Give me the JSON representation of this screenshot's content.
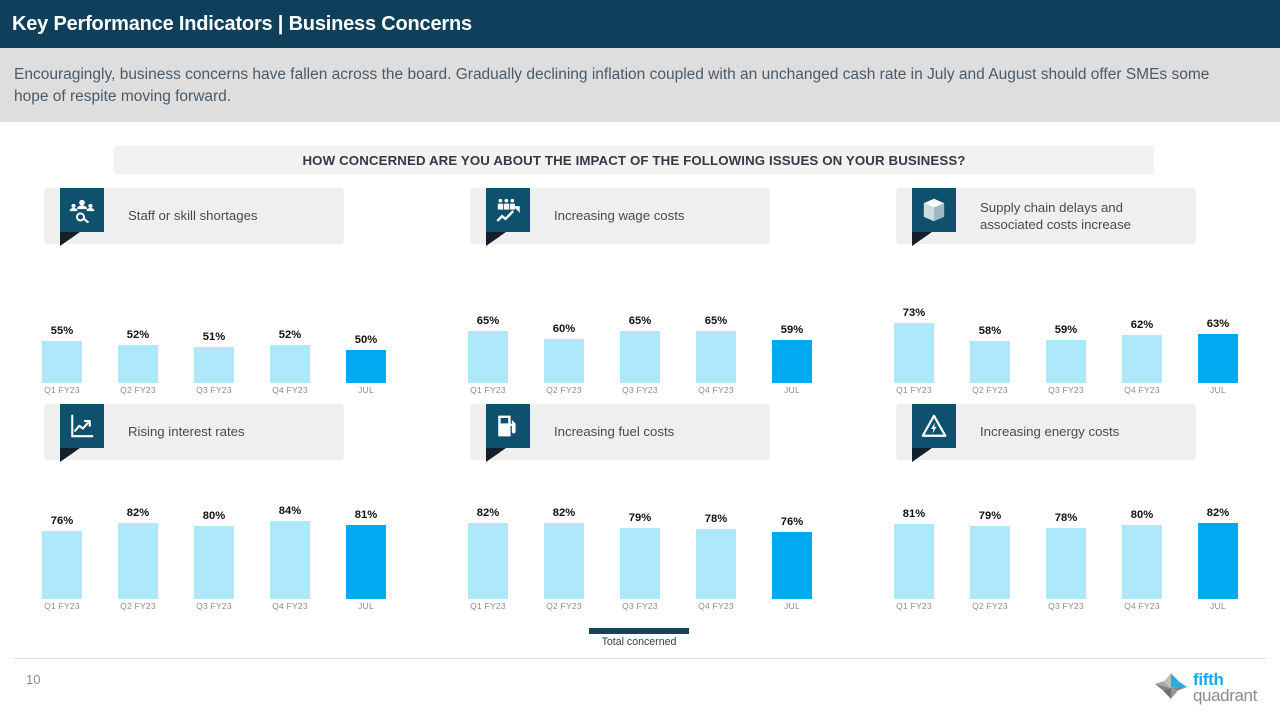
{
  "header": {
    "title": "Key Performance Indicators | Business Concerns",
    "subtitle": "Encouragingly, business concerns have fallen across the board. Gradually declining inflation coupled with an unchanged cash rate in July and August should offer SMEs some hope of respite moving forward.",
    "bar_color": "#0E405C",
    "subtitle_band_color": "#DEDEDE"
  },
  "question": {
    "text": "HOW CONCERNED ARE YOU ABOUT THE IMPACT OF THE FOLLOWING ISSUES ON YOUR BUSINESS?"
  },
  "legend": {
    "label": "Total concerned",
    "swatch_color": "#14455F"
  },
  "footer": {
    "page_number": "10",
    "logo_word1": "fifth",
    "logo_word2": "quadrant",
    "logo_accent": "#1CA8E8",
    "logo_gray": "#8C8C8C"
  },
  "colors": {
    "bar": "#ADE8FB",
    "bar_highlight": "#00A9F0",
    "icon_box": "#0E506D",
    "panel_plate": "#EFEFEF"
  },
  "chart_data": [
    {
      "type": "bar",
      "title": "Staff or skill shortages",
      "icon": "people-search-icon",
      "categories": [
        "Q1 FY23",
        "Q2 FY23",
        "Q3 FY23",
        "Q4 FY23",
        "JUL"
      ],
      "values": [
        55,
        52,
        51,
        52,
        50
      ],
      "labels": [
        "55%",
        "52%",
        "51%",
        "52%",
        "50%"
      ],
      "highlight_index": 4,
      "ylabel": "Total concerned",
      "ylim": [
        0,
        100
      ]
    },
    {
      "type": "bar",
      "title": "Increasing wage costs",
      "icon": "wage-growth-icon",
      "categories": [
        "Q1 FY23",
        "Q2 FY23",
        "Q3 FY23",
        "Q4 FY23",
        "JUL"
      ],
      "values": [
        65,
        60,
        65,
        65,
        59
      ],
      "labels": [
        "65%",
        "60%",
        "65%",
        "65%",
        "59%"
      ],
      "highlight_index": 4,
      "ylabel": "Total concerned",
      "ylim": [
        0,
        100
      ]
    },
    {
      "type": "bar",
      "title": "Supply chain delays and associated costs increase",
      "icon": "package-box-icon",
      "categories": [
        "Q1 FY23",
        "Q2 FY23",
        "Q3 FY23",
        "Q4 FY23",
        "JUL"
      ],
      "values": [
        73,
        58,
        59,
        62,
        63
      ],
      "labels": [
        "73%",
        "58%",
        "59%",
        "62%",
        "63%"
      ],
      "highlight_index": 4,
      "ylabel": "Total concerned",
      "ylim": [
        0,
        100
      ]
    },
    {
      "type": "bar",
      "title": "Rising interest rates",
      "icon": "line-chart-up-icon",
      "categories": [
        "Q1 FY23",
        "Q2 FY23",
        "Q3 FY23",
        "Q4 FY23",
        "JUL"
      ],
      "values": [
        76,
        82,
        80,
        84,
        81
      ],
      "labels": [
        "76%",
        "82%",
        "80%",
        "84%",
        "81%"
      ],
      "highlight_index": 4,
      "ylabel": "Total concerned",
      "ylim": [
        0,
        100
      ]
    },
    {
      "type": "bar",
      "title": "Increasing fuel costs",
      "icon": "fuel-pump-icon",
      "categories": [
        "Q1 FY23",
        "Q2 FY23",
        "Q3 FY23",
        "Q4 FY23",
        "JUL"
      ],
      "values": [
        82,
        82,
        79,
        78,
        76
      ],
      "labels": [
        "82%",
        "82%",
        "79%",
        "78%",
        "76%"
      ],
      "highlight_index": 4,
      "ylabel": "Total concerned",
      "ylim": [
        0,
        100
      ]
    },
    {
      "type": "bar",
      "title": "Increasing energy costs",
      "icon": "energy-warning-icon",
      "categories": [
        "Q1 FY23",
        "Q2 FY23",
        "Q3 FY23",
        "Q4 FY23",
        "JUL"
      ],
      "values": [
        81,
        79,
        78,
        80,
        82
      ],
      "labels": [
        "81%",
        "79%",
        "78%",
        "80%",
        "82%"
      ],
      "highlight_index": 4,
      "ylabel": "Total concerned",
      "ylim": [
        0,
        100
      ]
    }
  ]
}
